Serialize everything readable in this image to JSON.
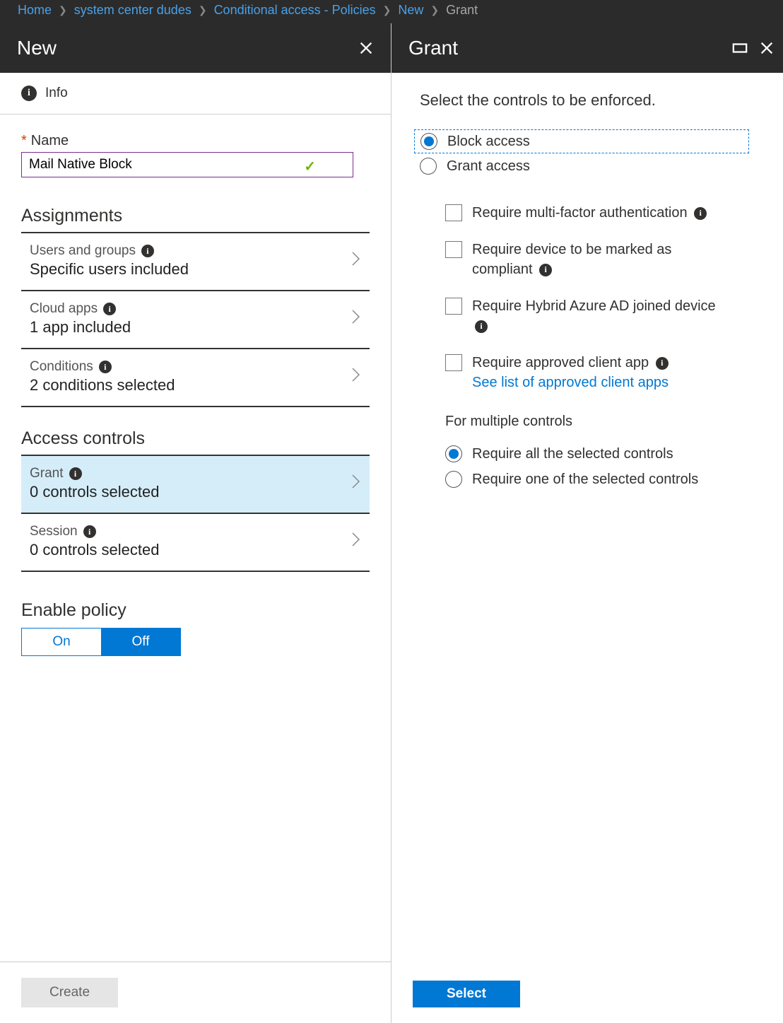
{
  "breadcrumb": {
    "items": [
      "Home",
      "system center dudes",
      "Conditional access - Policies",
      "New"
    ],
    "current": "Grant"
  },
  "left": {
    "title": "New",
    "info_label": "Info",
    "name_label": "Name",
    "name_value": "Mail Native Block",
    "sections": {
      "assignments": {
        "title": "Assignments",
        "rows": [
          {
            "label": "Users and groups",
            "value": "Specific users included"
          },
          {
            "label": "Cloud apps",
            "value": "1 app included"
          },
          {
            "label": "Conditions",
            "value": "2 conditions selected"
          }
        ]
      },
      "access": {
        "title": "Access controls",
        "rows": [
          {
            "label": "Grant",
            "value": "0 controls selected",
            "selected": true
          },
          {
            "label": "Session",
            "value": "0 controls selected"
          }
        ]
      }
    },
    "enable": {
      "title": "Enable policy",
      "on": "On",
      "off": "Off",
      "active": "Off"
    },
    "create_btn": "Create"
  },
  "right": {
    "title": "Grant",
    "prompt": "Select the controls to be enforced.",
    "radio_block": "Block access",
    "radio_grant": "Grant access",
    "checks": [
      "Require multi-factor authentication",
      "Require device to be marked as compliant",
      "Require Hybrid Azure AD joined device",
      "Require approved client app"
    ],
    "approved_link": "See list of approved client apps",
    "multi_title": "For multiple controls",
    "multi_all": "Require all the selected controls",
    "multi_one": "Require one of the selected controls",
    "select_btn": "Select"
  }
}
